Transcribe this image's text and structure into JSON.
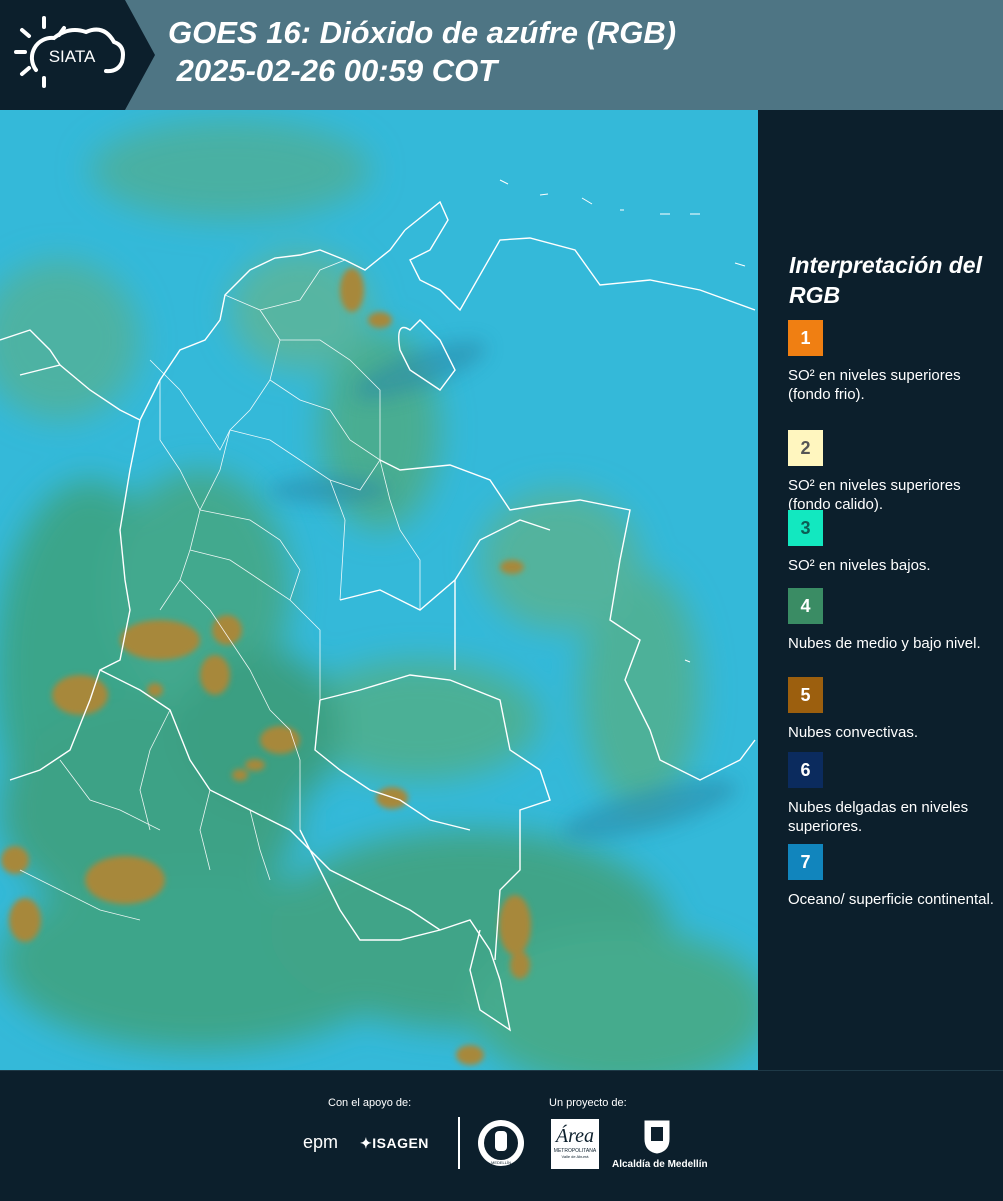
{
  "header": {
    "logo_text": "SIATA",
    "title_line1": "GOES 16: Dióxido de azúfre (RGB)",
    "title_line2": " 2025-02-26 00:59 COT"
  },
  "legend": {
    "title": "Interpretación del RGB",
    "items": [
      {
        "number": "1",
        "color": "#f07f12",
        "label": "SO² en niveles superiores (fondo frio)."
      },
      {
        "number": "2",
        "color": "#fff6bf",
        "label": "SO² en niveles superiores (fondo calido)."
      },
      {
        "number": "3",
        "color": "#12e8c0",
        "label": "SO² en niveles bajos."
      },
      {
        "number": "4",
        "color": "#3a8c64",
        "label": "Nubes de medio y bajo nivel."
      },
      {
        "number": "5",
        "color": "#9c5f0e",
        "label": "Nubes convectivas."
      },
      {
        "number": "6",
        "color": "#0b2b5e",
        "label": "Nubes delgadas en niveles superiores."
      },
      {
        "number": "7",
        "color": "#1185bd",
        "label": "Oceano/ superficie continental."
      }
    ]
  },
  "footer": {
    "support_label": "Con el apoyo de:",
    "project_label": "Un proyecto de:",
    "epm_logo": "epm",
    "isagen_logo": "ISAGEN",
    "area_logo_text": "Área",
    "area_logo_sub": "METROPOLITANA",
    "area_logo_sub2": "Valle de Aburrá",
    "alcaldia_logo": "Alcaldía de Medellín",
    "medellin_seal_text": "MEDELLÍN"
  }
}
